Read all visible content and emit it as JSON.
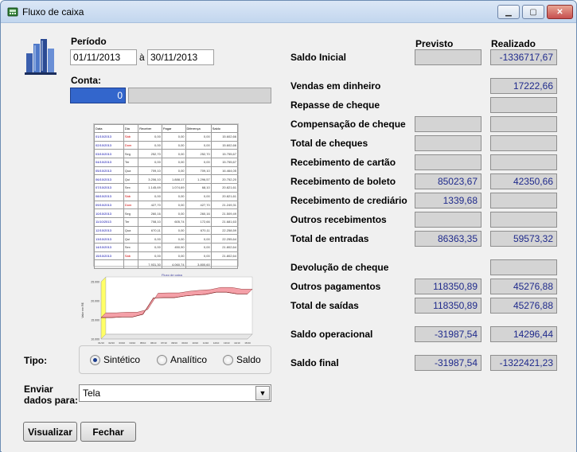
{
  "window": {
    "title": "Fluxo de caixa",
    "minimize_icon": "minimize-icon",
    "maximize_icon": "maximize-icon",
    "close_icon": "close-icon"
  },
  "periodo": {
    "label": "Período",
    "inicio": "01/11/2013",
    "separador": "à",
    "fim": "30/11/2013"
  },
  "conta": {
    "label": "Conta:",
    "codigo": "0",
    "descricao": ""
  },
  "preview_table": {
    "headers": [
      "Data",
      "Dia",
      "Receber",
      "Pagar",
      "Diferença",
      "Saldo"
    ],
    "rows": [
      [
        "01/10/2013",
        "Sáb",
        "0,00",
        "0,00",
        "0,00",
        "15.602,66"
      ],
      [
        "02/10/2013",
        "Dom",
        "0,00",
        "0,00",
        "0,00",
        "15.602,66"
      ],
      [
        "03/10/2013",
        "Seg",
        "252,70",
        "0,00",
        "252,70",
        "15.755,67"
      ],
      [
        "04/10/2013",
        "Ter",
        "0,00",
        "0,00",
        "0,00",
        "15.755,67"
      ],
      [
        "05/10/2013",
        "Qua",
        "709,10",
        "0,00",
        "709,10",
        "16.464,05"
      ],
      [
        "06/10/2013",
        "Qui",
        "3.206,10",
        "1.888,17",
        "1.296,57",
        "20.752,20"
      ],
      [
        "07/10/2013",
        "Sex",
        "1.145,69",
        "1.074,69",
        "68,10",
        "20.821,61"
      ],
      [
        "08/10/2013",
        "Sáb",
        "0,00",
        "0,00",
        "0,00",
        "20.821,61"
      ],
      [
        "09/10/2013",
        "Dom",
        "427,70",
        "0,00",
        "427,70",
        "21.249,31"
      ],
      [
        "10/10/2013",
        "Seg",
        "260,16",
        "0,00",
        "260,16",
        "21.509,49"
      ],
      [
        "11/10/2013",
        "Ter",
        "708,10",
        "605,74",
        "172,66",
        "21.681,63"
      ],
      [
        "12/10/2013",
        "Qua",
        "670,11",
        "0,00",
        "670,11",
        "22.258,59"
      ],
      [
        "13/10/2013",
        "Qui",
        "0,00",
        "0,00",
        "0,00",
        "22.255,64"
      ],
      [
        "14/10/2013",
        "Sex",
        "0,00",
        "450,90",
        "0,00",
        "21.802,64"
      ],
      [
        "15/10/2013",
        "Sáb",
        "0,00",
        "0,00",
        "0,00",
        "21.802,64"
      ]
    ],
    "totals": [
      "",
      "",
      "7.931,30",
      "4.060,74",
      "3.800,60",
      ""
    ]
  },
  "preview_chart": {
    "title": "Fluxo de caixa",
    "ylabel": "Valor em R$",
    "xlabel": "Dia",
    "y_ticks": [
      "25.000",
      "20.000",
      "15.000",
      "10.000"
    ],
    "x_ticks": [
      "01/10",
      "02/10",
      "03/10",
      "04/10",
      "05/10",
      "06/10",
      "07/10",
      "08/10",
      "09/10",
      "10/10",
      "11/10",
      "12/10",
      "13/10",
      "14/10",
      "15/10"
    ],
    "series": [
      {
        "values": [
          15602.66,
          15602.66,
          15755.67,
          15755.67,
          16464.05,
          20752.2,
          20821.61,
          20821.61,
          21249.31,
          21509.49,
          21681.63,
          22258.59,
          22255.64,
          21802.64,
          21802.64
        ]
      }
    ],
    "colors": {
      "band": "#f4a0a8",
      "wall": "#ffff66",
      "line": "#7a1a1a"
    }
  },
  "tipo": {
    "label": "Tipo:",
    "options": [
      "Sintético",
      "Analítico",
      "Saldo"
    ],
    "selected": "Sintético"
  },
  "enviar": {
    "label_line1": "Enviar",
    "label_line2": "dados para:",
    "value": "Tela"
  },
  "buttons": {
    "visualizar": "Visualizar",
    "fechar": "Fechar"
  },
  "summary": {
    "col_previsto": "Previsto",
    "col_realizado": "Realizado",
    "saldo_inicial": {
      "label": "Saldo Inicial",
      "previsto": "",
      "realizado": "-1336717,67"
    },
    "vendas_dinheiro": {
      "label": "Vendas em dinheiro",
      "realizado": "17222,66"
    },
    "repasse_cheque": {
      "label": "Repasse de cheque",
      "realizado": ""
    },
    "compensacao_cheque": {
      "label": "Compensação de cheque",
      "previsto": "",
      "realizado": ""
    },
    "total_cheques": {
      "label": "Total de cheques",
      "previsto": "",
      "realizado": ""
    },
    "recebimento_cartao": {
      "label": "Recebimento de cartão",
      "previsto": "",
      "realizado": ""
    },
    "recebimento_boleto": {
      "label": "Recebimento de boleto",
      "previsto": "85023,67",
      "realizado": "42350,66"
    },
    "recebimento_crediario": {
      "label": "Recebimento de crediário",
      "previsto": "1339,68",
      "realizado": ""
    },
    "outros_recebimentos": {
      "label": "Outros recebimentos",
      "previsto": "",
      "realizado": ""
    },
    "total_entradas": {
      "label": "Total de entradas",
      "previsto": "86363,35",
      "realizado": "59573,32"
    },
    "devolucao_cheque": {
      "label": "Devolução de cheque",
      "realizado": ""
    },
    "outros_pagamentos": {
      "label": "Outros pagamentos",
      "previsto": "118350,89",
      "realizado": "45276,88"
    },
    "total_saidas": {
      "label": "Total de saídas",
      "previsto": "118350,89",
      "realizado": "45276,88"
    },
    "saldo_operacional": {
      "label": "Saldo operacional",
      "previsto": "-31987,54",
      "realizado": "14296,44"
    },
    "saldo_final": {
      "label": "Saldo final",
      "previsto": "-31987,54",
      "realizado": "-1322421,23"
    }
  },
  "icons": {
    "app": "cash-register-icon",
    "report": "bar-chart-icon"
  }
}
